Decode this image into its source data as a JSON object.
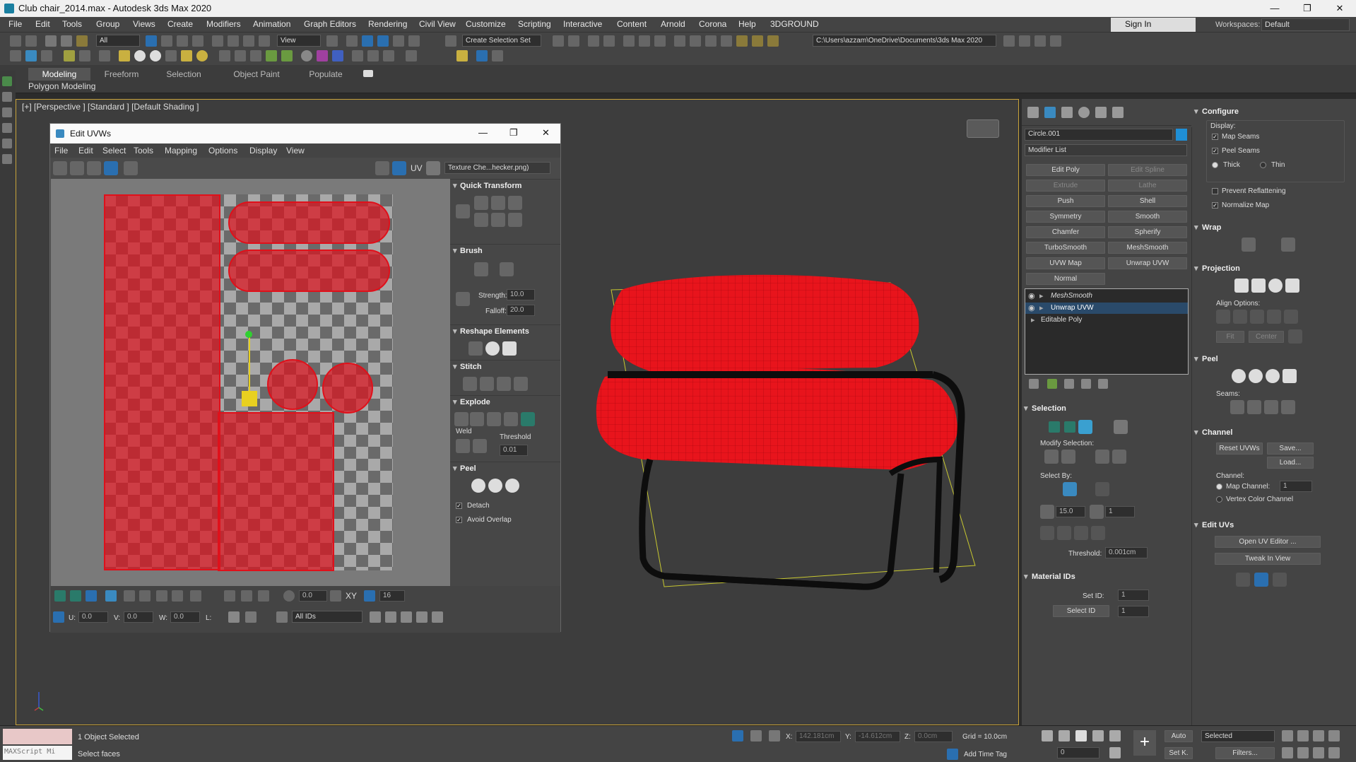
{
  "window": {
    "title": "Club chair_2014.max - Autodesk 3ds Max 2020",
    "min": "—",
    "max": "❐",
    "close": "✕"
  },
  "menu": [
    "File",
    "Edit",
    "Tools",
    "Group",
    "Views",
    "Create",
    "Modifiers",
    "Animation",
    "Graph Editors",
    "Rendering",
    "Civil View",
    "Customize",
    "Scripting",
    "Interactive",
    "Content",
    "Arnold",
    "Corona",
    "Help",
    "3DGROUND"
  ],
  "account": {
    "signin": "Sign In",
    "workspaces_label": "Workspaces:",
    "workspace": "Default"
  },
  "toolbar": {
    "filter": "All",
    "view": "View",
    "selection_set": "Create Selection Set",
    "path": "C:\\Users\\azzam\\OneDrive\\Documents\\3ds Max 2020"
  },
  "ribbon": {
    "tabs": [
      "Modeling",
      "Freeform",
      "Selection",
      "Object Paint",
      "Populate"
    ],
    "sub": "Polygon Modeling"
  },
  "viewport": {
    "label": "[+] [Perspective ] [Standard ] [Default Shading ]"
  },
  "uvw": {
    "title": "Edit UVWs",
    "menu": [
      "File",
      "Edit",
      "Select",
      "Tools",
      "Mapping",
      "Options",
      "Display",
      "View"
    ],
    "uv_label": "UV",
    "texture": "Texture Che...hecker.png)",
    "quick_transform": "Quick Transform",
    "brush": "Brush",
    "strength_label": "Strength:",
    "strength": "10.0",
    "falloff_label": "Falloff:",
    "falloff": "20.0",
    "reshape": "Reshape Elements",
    "stitch": "Stitch",
    "explode": "Explode",
    "weld": "Weld",
    "threshold_label": "Threshold",
    "threshold": "0.01",
    "peel": "Peel",
    "detach": "Detach",
    "avoid_overlap": "Avoid Overlap",
    "u_label": "U:",
    "u": "0.0",
    "v_label": "V:",
    "v": "0.0",
    "w_label": "W:",
    "w": "0.0",
    "l_label": "L:",
    "ids": "All IDs",
    "spin_a": "0.0",
    "spin_b": "16",
    "xy": "XY"
  },
  "modify": {
    "object_name": "Circle.001",
    "modifier_list": "Modifier List",
    "buttons": [
      [
        "Edit Poly",
        "Edit Spline"
      ],
      [
        "Extrude",
        "Lathe"
      ],
      [
        "Push",
        "Shell"
      ],
      [
        "Symmetry",
        "Smooth"
      ],
      [
        "Chamfer",
        "Spherify"
      ],
      [
        "TurboSmooth",
        "MeshSmooth"
      ],
      [
        "UVW Map",
        "Unwrap UVW"
      ],
      [
        "Normal",
        ""
      ]
    ],
    "stack": [
      "MeshSmooth",
      "Unwrap UVW",
      "Editable Poly"
    ],
    "selection": "Selection",
    "modify_selection": "Modify Selection:",
    "select_by": "Select By:",
    "angle": "15.0",
    "count": "1",
    "threshold_label": "Threshold:",
    "threshold": "0.001cm",
    "material_ids": "Material IDs",
    "set_id_label": "Set ID:",
    "set_id": "1",
    "select_id": "Select ID",
    "select_id_val": "1"
  },
  "configure": {
    "title": "Configure",
    "display": "Display:",
    "map_seams": "Map Seams",
    "peel_seams": "Peel Seams",
    "thick": "Thick",
    "thin": "Thin",
    "prevent": "Prevent Reflattening",
    "normalize": "Normalize Map",
    "wrap": "Wrap",
    "projection": "Projection",
    "align": "Align Options:",
    "fit": "Fit",
    "center": "Center",
    "peel": "Peel",
    "seams": "Seams:",
    "channel": "Channel",
    "reset": "Reset UVWs",
    "save": "Save...",
    "load": "Load...",
    "channel_label": "Channel:",
    "map_channel": "Map Channel:",
    "map_channel_val": "1",
    "vertex_color": "Vertex Color Channel",
    "edit_uvs": "Edit UVs",
    "open_editor": "Open UV Editor ...",
    "tweak": "Tweak In View"
  },
  "status": {
    "script": "MAXScript Mi",
    "selected": "1 Object Selected",
    "prompt": "Select faces",
    "x_label": "X:",
    "x": "142.181cm",
    "y_label": "Y:",
    "y": "-14.612cm",
    "z_label": "Z:",
    "z": "0.0cm",
    "grid": "Grid = 10.0cm",
    "add_time_tag": "Add Time Tag",
    "auto": "Auto",
    "selected_mode": "Selected",
    "set_k": "Set K.",
    "filters": "Filters...",
    "frame": "0"
  },
  "colors": {
    "accent": "#1f8fd6",
    "uv_red": "#e0101a",
    "active_border": "#c9a33a"
  }
}
